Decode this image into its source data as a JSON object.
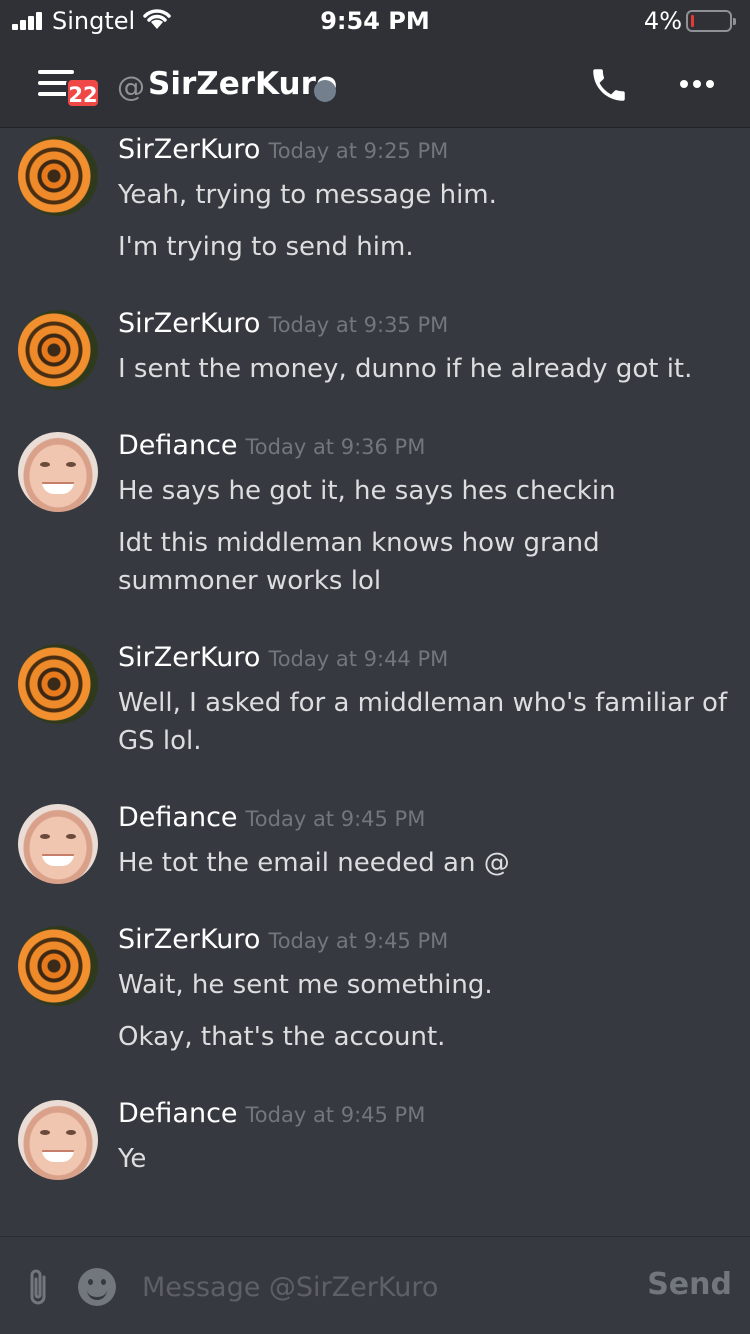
{
  "status_bar": {
    "carrier": "Singtel",
    "time": "9:54 PM",
    "battery_percent": "4%"
  },
  "header": {
    "unread_badge": "22",
    "at_symbol": "@",
    "channel_name": "SirZerKuro",
    "icons": [
      "hamburger-menu-icon",
      "phone-icon",
      "more-icon"
    ]
  },
  "messages": [
    {
      "author": "SirZerKuro",
      "timestamp": "Today at 9:25 PM",
      "avatar": "obito-mask",
      "lines": [
        "Yeah, trying to message him.",
        "I'm trying to send him."
      ]
    },
    {
      "author": "SirZerKuro",
      "timestamp": "Today at 9:35 PM",
      "avatar": "obito-mask",
      "lines": [
        "I sent the money, dunno if he already got it."
      ]
    },
    {
      "author": "Defiance",
      "timestamp": "Today at 9:36 PM",
      "avatar": "harold",
      "lines": [
        "He says he got it, he says hes checkin",
        "Idt this middleman knows how grand summoner works lol"
      ]
    },
    {
      "author": "SirZerKuro",
      "timestamp": "Today at 9:44 PM",
      "avatar": "obito-mask",
      "lines": [
        "Well, I asked for a middleman who's familiar of GS lol."
      ]
    },
    {
      "author": "Defiance",
      "timestamp": "Today at 9:45 PM",
      "avatar": "harold",
      "lines": [
        "He tot the email needed an @"
      ]
    },
    {
      "author": "SirZerKuro",
      "timestamp": "Today at 9:45 PM",
      "avatar": "obito-mask",
      "lines": [
        "Wait, he sent me something.",
        "Okay, that's the account."
      ]
    },
    {
      "author": "Defiance",
      "timestamp": "Today at 9:45 PM",
      "avatar": "harold",
      "lines": [
        "Ye"
      ]
    }
  ],
  "composer": {
    "placeholder": "Message @SirZerKuro",
    "send_label": "Send"
  }
}
